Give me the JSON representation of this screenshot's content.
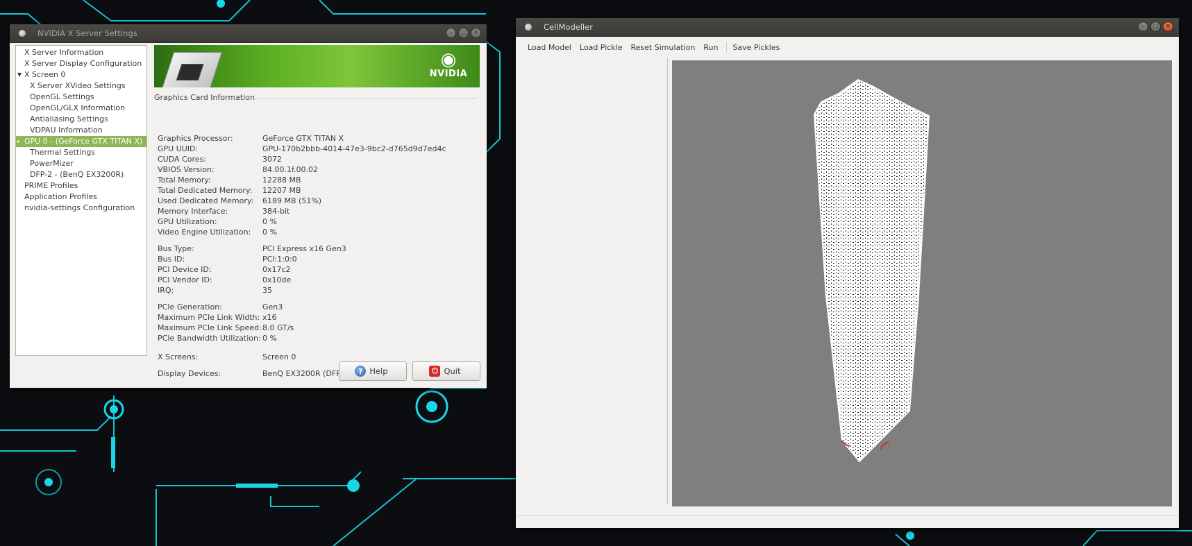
{
  "nvidia": {
    "title": "NVIDIA X Server Settings",
    "tree": [
      {
        "label": "X Server Information",
        "level": 0
      },
      {
        "label": "X Server Display Configuration",
        "level": 0
      },
      {
        "label": "X Screen 0",
        "level": 0,
        "expanded": true
      },
      {
        "label": "X Server XVideo Settings",
        "level": 1
      },
      {
        "label": "OpenGL Settings",
        "level": 1
      },
      {
        "label": "OpenGL/GLX Information",
        "level": 1
      },
      {
        "label": "Antialiasing Settings",
        "level": 1
      },
      {
        "label": "VDPAU Information",
        "level": 1
      },
      {
        "label": "GPU 0 - (GeForce GTX TITAN X)",
        "level": 0,
        "selected": true
      },
      {
        "label": "Thermal Settings",
        "level": 1
      },
      {
        "label": "PowerMizer",
        "level": 1
      },
      {
        "label": "DFP-2 - (BenQ EX3200R)",
        "level": 1
      },
      {
        "label": "PRIME Profiles",
        "level": 0
      },
      {
        "label": "Application Profiles",
        "level": 0
      },
      {
        "label": "nvidia-settings Configuration",
        "level": 0
      }
    ],
    "banner_logo_text": "NVIDIA",
    "section_heading": "Graphics Card Information",
    "info": [
      {
        "label": "Graphics Processor:",
        "value": "GeForce GTX TITAN X"
      },
      {
        "label": "GPU UUID:",
        "value": "GPU-170b2bbb-4014-47e3-9bc2-d765d9d7ed4c"
      },
      {
        "label": "CUDA Cores:",
        "value": "3072"
      },
      {
        "label": "VBIOS Version:",
        "value": "84.00.1f.00.02"
      },
      {
        "label": "Total Memory:",
        "value": "12288 MB"
      },
      {
        "label": "Total Dedicated Memory:",
        "value": "12207 MB"
      },
      {
        "label": "Used Dedicated Memory:",
        "value": "6189 MB (51%)"
      },
      {
        "label": "Memory Interface:",
        "value": "384-bit"
      },
      {
        "label": "GPU Utilization:",
        "value": "0 %"
      },
      {
        "label": "Video Engine Utilization:",
        "value": "0 %"
      },
      {
        "label": "Bus Type:",
        "value": "PCI Express x16 Gen3"
      },
      {
        "label": "Bus ID:",
        "value": "PCI:1:0:0"
      },
      {
        "label": "PCI Device ID:",
        "value": "0x17c2"
      },
      {
        "label": "PCI Vendor ID:",
        "value": "0x10de"
      },
      {
        "label": "IRQ:",
        "value": "35"
      },
      {
        "label": "PCIe Generation:",
        "value": "Gen3"
      },
      {
        "label": "Maximum PCIe Link Width:",
        "value": "x16"
      },
      {
        "label": "Maximum PCIe Link Speed:",
        "value": "8.0 GT/s"
      },
      {
        "label": "PCIe Bandwidth Utilization:",
        "value": "0 %"
      },
      {
        "label": "X Screens:",
        "value": "Screen 0"
      },
      {
        "label": "Display Devices:",
        "value": "BenQ EX3200R (DFP-2)"
      }
    ],
    "help_label": "Help",
    "quit_label": "Quit"
  },
  "cellmodeller": {
    "title": "CellModeller",
    "menu": [
      "Load Model",
      "Load Pickle",
      "Reset Simulation",
      "Run",
      "Save Pickles"
    ],
    "viewport_background": "#7f7f7f",
    "cell_color": "#ffffff",
    "highlight_color": "#d22a2a"
  },
  "theme": {
    "wallpaper": "#0b0d10",
    "circuit": "#19d6e6",
    "nvidia_green": "#76b900",
    "selection_green": "#8fb555"
  }
}
